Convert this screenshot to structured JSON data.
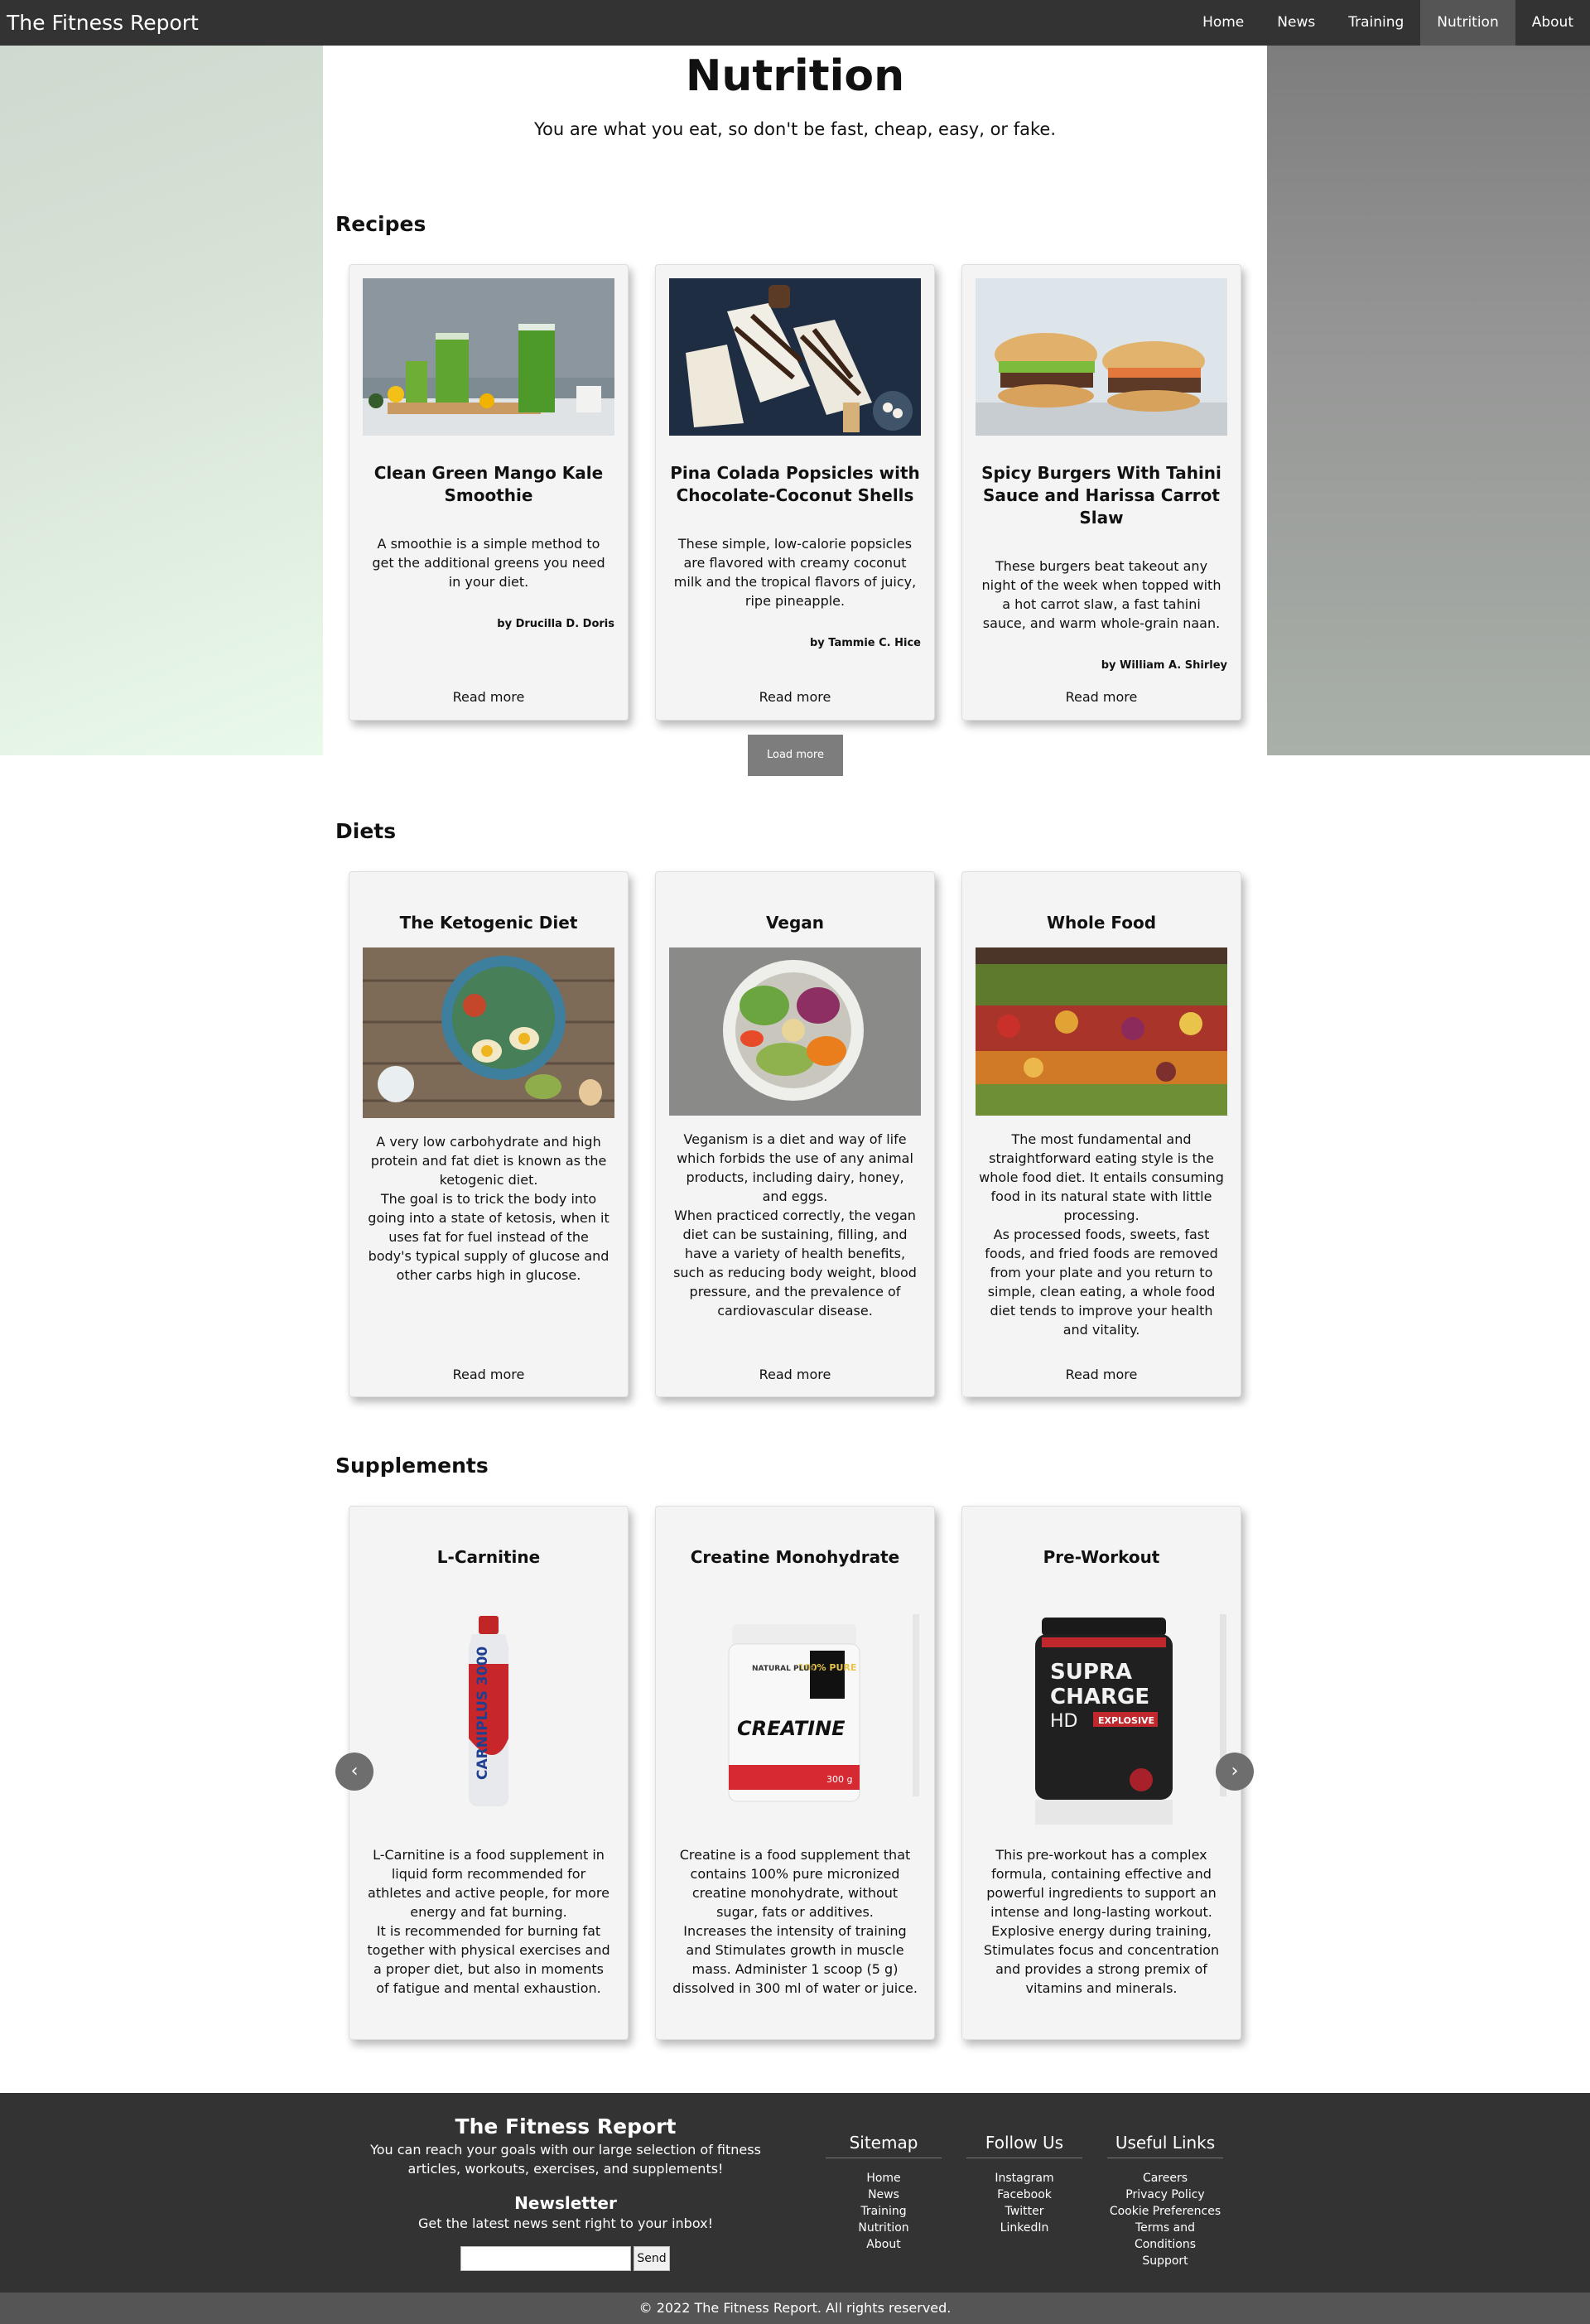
{
  "nav": {
    "brand": "The Fitness Report",
    "links": [
      "Home",
      "News",
      "Training",
      "Nutrition",
      "About"
    ],
    "active": "Nutrition"
  },
  "header": {
    "title": "Nutrition",
    "tagline": "You are what you eat, so don't be fast, cheap, easy, or fake."
  },
  "recipes": {
    "title": "Recipes",
    "items": [
      {
        "title": "Clean Green Mango Kale Smoothie",
        "desc": "A smoothie is a simple method to get the additional greens you need in your diet.",
        "author": "by Drucilla D. Doris",
        "read_more": "Read more"
      },
      {
        "title": "Pina Colada Popsicles with Chocolate-Coconut Shells",
        "desc": "These simple, low-calorie popsicles are flavored with creamy coconut milk and the tropical flavors of juicy, ripe pineapple.",
        "author": "by Tammie C. Hice",
        "read_more": "Read more"
      },
      {
        "title": "Spicy Burgers With Tahini Sauce and Harissa Carrot Slaw",
        "desc": "These burgers beat takeout any night of the week when topped with a hot carrot slaw, a fast tahini sauce, and warm whole-grain naan.",
        "author": "by William A. Shirley",
        "read_more": "Read more"
      }
    ],
    "load_more": "Load more"
  },
  "diets": {
    "title": "Diets",
    "items": [
      {
        "title": "The Ketogenic Diet",
        "desc1": "A very low carbohydrate and high protein and fat diet is known as the ketogenic diet.",
        "desc2": "The goal is to trick the body into going into a state of ketosis, when it uses fat for fuel instead of the body's typical supply of glucose and other carbs high in glucose.",
        "read_more": "Read more"
      },
      {
        "title": "Vegan",
        "desc1": "Veganism is a diet and way of life which forbids the use of any animal products, including dairy, honey, and eggs.",
        "desc2": "When practiced correctly, the vegan diet can be sustaining, filling, and have a variety of health benefits, such as reducing body weight, blood pressure, and the prevalence of cardiovascular disease.",
        "read_more": "Read more"
      },
      {
        "title": "Whole Food",
        "desc1": "The most fundamental and straightforward eating style is the whole food diet. It entails consuming food in its natural state with little processing.",
        "desc2": "As processed foods, sweets, fast foods, and fried foods are removed from your plate and you return to simple, clean eating, a whole food diet tends to improve your health and vitality.",
        "read_more": "Read more"
      }
    ]
  },
  "supplements": {
    "title": "Supplements",
    "items": [
      {
        "title": "L-Carnitine",
        "desc1": "L-Carnitine is a food supplement in liquid form recommended for athletes and active people, for more energy and fat burning.",
        "desc2": "It is recommended for burning fat together with physical exercises and a proper diet, but also in moments of fatigue and mental exhaustion."
      },
      {
        "title": "Creatine Monohydrate",
        "desc1": "Creatine is a food supplement that contains 100% pure micronized creatine monohydrate, without sugar, fats or additives.",
        "desc2": "Increases the intensity of training and Stimulates growth in muscle mass. Administer 1 scoop (5 g) dissolved in 300 ml of water or juice."
      },
      {
        "title": "Pre-Workout",
        "desc1": "This pre-workout has a complex formula, containing effective and powerful ingredients to support an intense and long-lasting workout. Explosive energy during training, Stimulates focus and concentration and provides a strong premix of vitamins and minerals.",
        "desc2": ""
      }
    ],
    "prev_icon": "chevron-left-icon",
    "next_icon": "chevron-right-icon",
    "labels": {
      "carnitine_top": "CARNIPLUS 3000",
      "creatine_brand": "NATURAL PLUS",
      "creatine_badge": "100% PURE",
      "creatine_name": "CREATINE",
      "creatine_weight": "300 g",
      "preworkout_name1": "SUPRA",
      "preworkout_name2": "CHARGE",
      "preworkout_name3": "HD",
      "preworkout_tag": "EXPLOSIVE"
    }
  },
  "footer": {
    "brand": "The Fitness Report",
    "sub": "You can reach your goals with our large selection of fitness articles, workouts, exercises, and supplements!",
    "newsletter_title": "Newsletter",
    "newsletter_sub": "Get the latest news sent right to your inbox!",
    "email_value": "",
    "send_label": "Send",
    "sitemap": {
      "title": "Sitemap",
      "links": [
        "Home",
        "News",
        "Training",
        "Nutrition",
        "About"
      ]
    },
    "follow": {
      "title": "Follow Us",
      "links": [
        "Instagram",
        "Facebook",
        "Twitter",
        "LinkedIn"
      ]
    },
    "useful": {
      "title": "Useful Links",
      "links": [
        "Careers",
        "Privacy Policy",
        "Cookie Preferences",
        "Terms and Conditions",
        "Support"
      ]
    },
    "copyright": "© 2022 The Fitness Report. All rights reserved."
  }
}
